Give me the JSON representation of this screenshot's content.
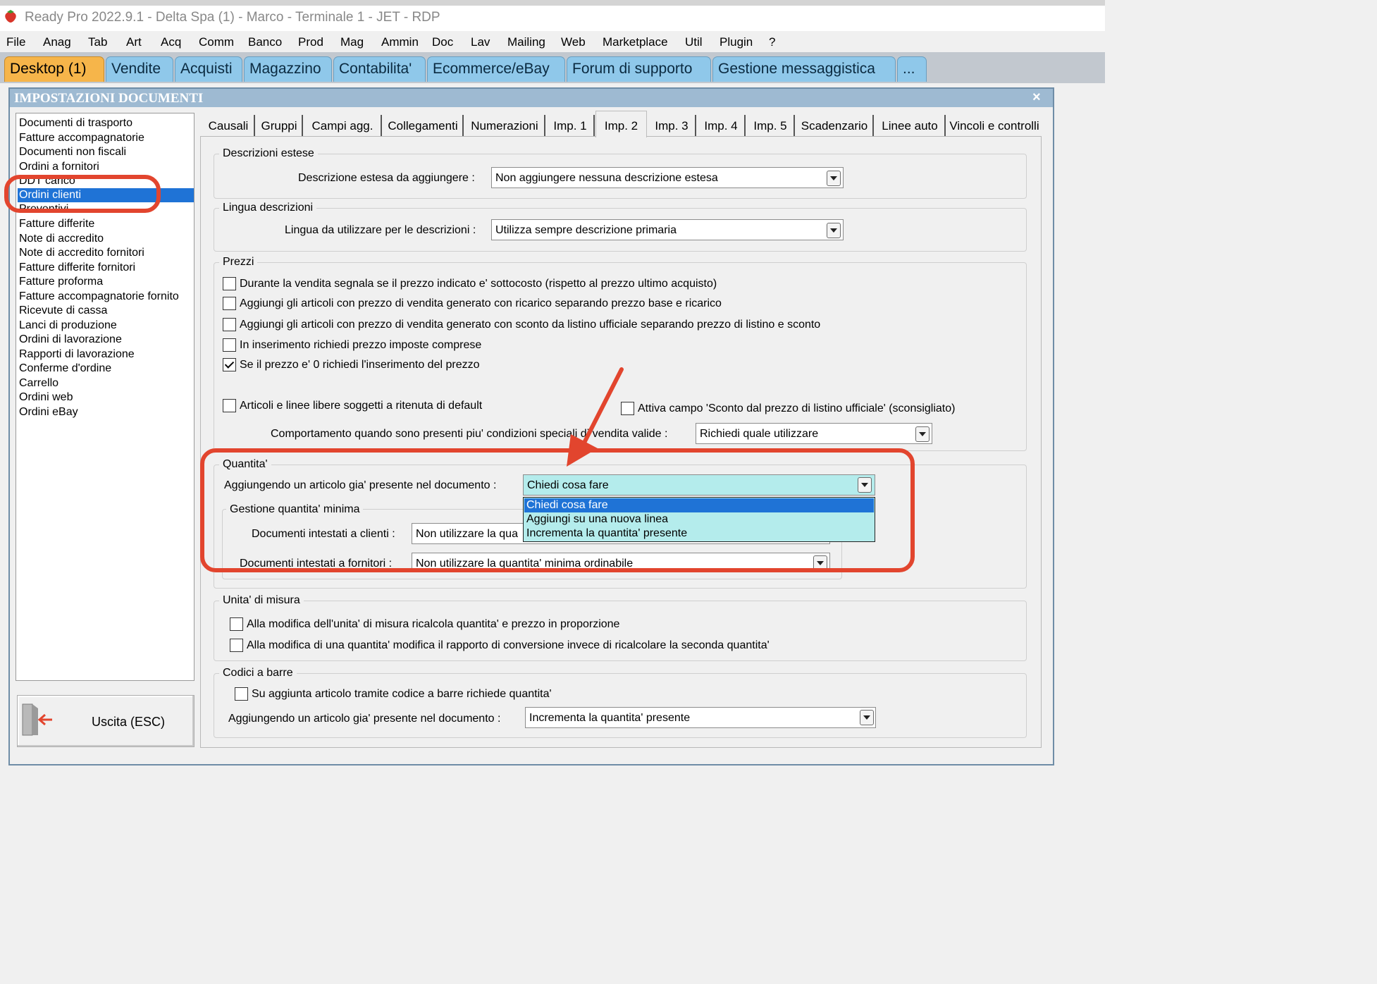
{
  "window": {
    "title": "Ready Pro 2022.9.1 - Delta Spa (1) - Marco - Terminale 1 - JET - RDP"
  },
  "menu": [
    "File",
    "Anag",
    "Tab",
    "Art",
    "Acq",
    "Comm",
    "Banco",
    "Prod",
    "Mag",
    "Ammin",
    "Doc",
    "Lav",
    "Mailing",
    "Web",
    "Marketplace",
    "Util",
    "Plugin",
    "?"
  ],
  "desktop_tabs": [
    {
      "label": "Desktop (1)",
      "active": true
    },
    {
      "label": "Vendite"
    },
    {
      "label": "Acquisti"
    },
    {
      "label": "Magazzino"
    },
    {
      "label": "Contabilita'"
    },
    {
      "label": "Ecommerce/eBay"
    },
    {
      "label": "Forum di supporto"
    },
    {
      "label": "Gestione messaggistica"
    },
    {
      "label": "..."
    }
  ],
  "dialog": {
    "title": "IMPOSTAZIONI DOCUMENTI",
    "close": "×"
  },
  "doc_types": [
    "Documenti di trasporto",
    "Fatture accompagnatorie",
    "Documenti non fiscali",
    "Ordini a fornitori",
    "DDT carico",
    "Ordini clienti",
    "Preventivi",
    "Fatture differite",
    "Note di accredito",
    "Note di accredito fornitori",
    "Fatture differite fornitori",
    "Fatture proforma",
    "Fatture accompagnatorie fornito",
    "Ricevute di cassa",
    "Lanci di produzione",
    "Ordini di lavorazione",
    "Rapporti di lavorazione",
    "Conferme d'ordine",
    "Carrello",
    "Ordini web",
    "Ordini eBay"
  ],
  "selected_doc_type": "Ordini clienti",
  "exit_button": "Uscita (ESC)",
  "settings_tabs": [
    "Causali",
    "Gruppi",
    "Campi agg.",
    "Collegamenti",
    "Numerazioni",
    "Imp. 1",
    "Imp. 2",
    "Imp. 3",
    "Imp. 4",
    "Imp. 5",
    "Scadenzario",
    "Linee auto",
    "Vincoli e controlli"
  ],
  "active_settings_tab": "Imp. 2",
  "descrizioni_estese": {
    "title": "Descrizioni estese",
    "label": "Descrizione estesa da aggiungere :",
    "value": "Non aggiungere nessuna descrizione estesa"
  },
  "lingua": {
    "title": "Lingua descrizioni",
    "label": "Lingua da utilizzare per le descrizioni :",
    "value": "Utilizza sempre descrizione primaria"
  },
  "prezzi": {
    "title": "Prezzi",
    "checks": [
      {
        "label": "Durante la vendita segnala se il prezzo indicato e' sottocosto (rispetto al prezzo ultimo acquisto)",
        "checked": false
      },
      {
        "label": "Aggiungi gli articoli con prezzo di vendita generato con ricarico separando prezzo base e ricarico",
        "checked": false
      },
      {
        "label": "Aggiungi gli articoli con prezzo di vendita generato con sconto da listino ufficiale separando prezzo di listino e sconto",
        "checked": false
      },
      {
        "label": "In inserimento richiedi prezzo imposte comprese",
        "checked": false
      },
      {
        "label": "Se il prezzo e' 0 richiedi l'inserimento del prezzo",
        "checked": true
      },
      {
        "label": "Articoli e linee libere soggetti a ritenuta di default",
        "checked": false
      },
      {
        "label": "Attiva campo 'Sconto dal prezzo di listino ufficiale' (sconsigliato)",
        "checked": false
      }
    ],
    "behaviour_label": "Comportamento quando sono presenti piu' condizioni speciali di vendita valide :",
    "behaviour_value": "Richiedi quale utilizzare"
  },
  "quantita": {
    "title": "Quantita'",
    "label": "Aggiungendo un articolo gia' presente nel documento :",
    "value": "Chiedi cosa fare",
    "options": [
      "Chiedi cosa fare",
      "Aggiungi su una nuova linea",
      "Incrementa la quantita' presente"
    ],
    "min_title": "Gestione quantita' minima",
    "clienti_label": "Documenti intestati a clienti :",
    "clienti_value": "Non utilizzare la qua",
    "fornitori_label": "Documenti intestati a fornitori :",
    "fornitori_value": "Non utilizzare la quantita' minima ordinabile"
  },
  "unita": {
    "title": "Unita' di misura",
    "checks": [
      {
        "label": "Alla modifica dell'unita' di misura ricalcola quantita' e prezzo in proporzione",
        "checked": false
      },
      {
        "label": "Alla modifica di una quantita' modifica il rapporto di conversione invece di ricalcolare la seconda quantita'",
        "checked": false
      }
    ]
  },
  "barcode": {
    "title": "Codici a barre",
    "check": {
      "label": "Su aggiunta articolo tramite codice a barre richiede quantita'",
      "checked": false
    },
    "label": "Aggiungendo un articolo gia' presente nel documento :",
    "value": "Incrementa la quantita' presente"
  },
  "colors": {
    "selection": "#1f73d6",
    "highlight_field": "#b4ecec",
    "annotation": "#e2452e",
    "active_tab": "#f6b54a",
    "tab": "#8fc8ea"
  }
}
